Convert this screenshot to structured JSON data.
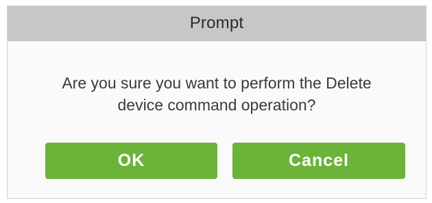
{
  "dialog": {
    "title": "Prompt",
    "message_line1": "Are you sure you want to perform the Delete",
    "message_line2": "device command operation?",
    "ok_label": "OK",
    "cancel_label": "Cancel"
  },
  "colors": {
    "titlebar": "#c7c7c7",
    "button": "#6cb33a",
    "button_text": "#ffffff",
    "body": "#fafafa"
  }
}
